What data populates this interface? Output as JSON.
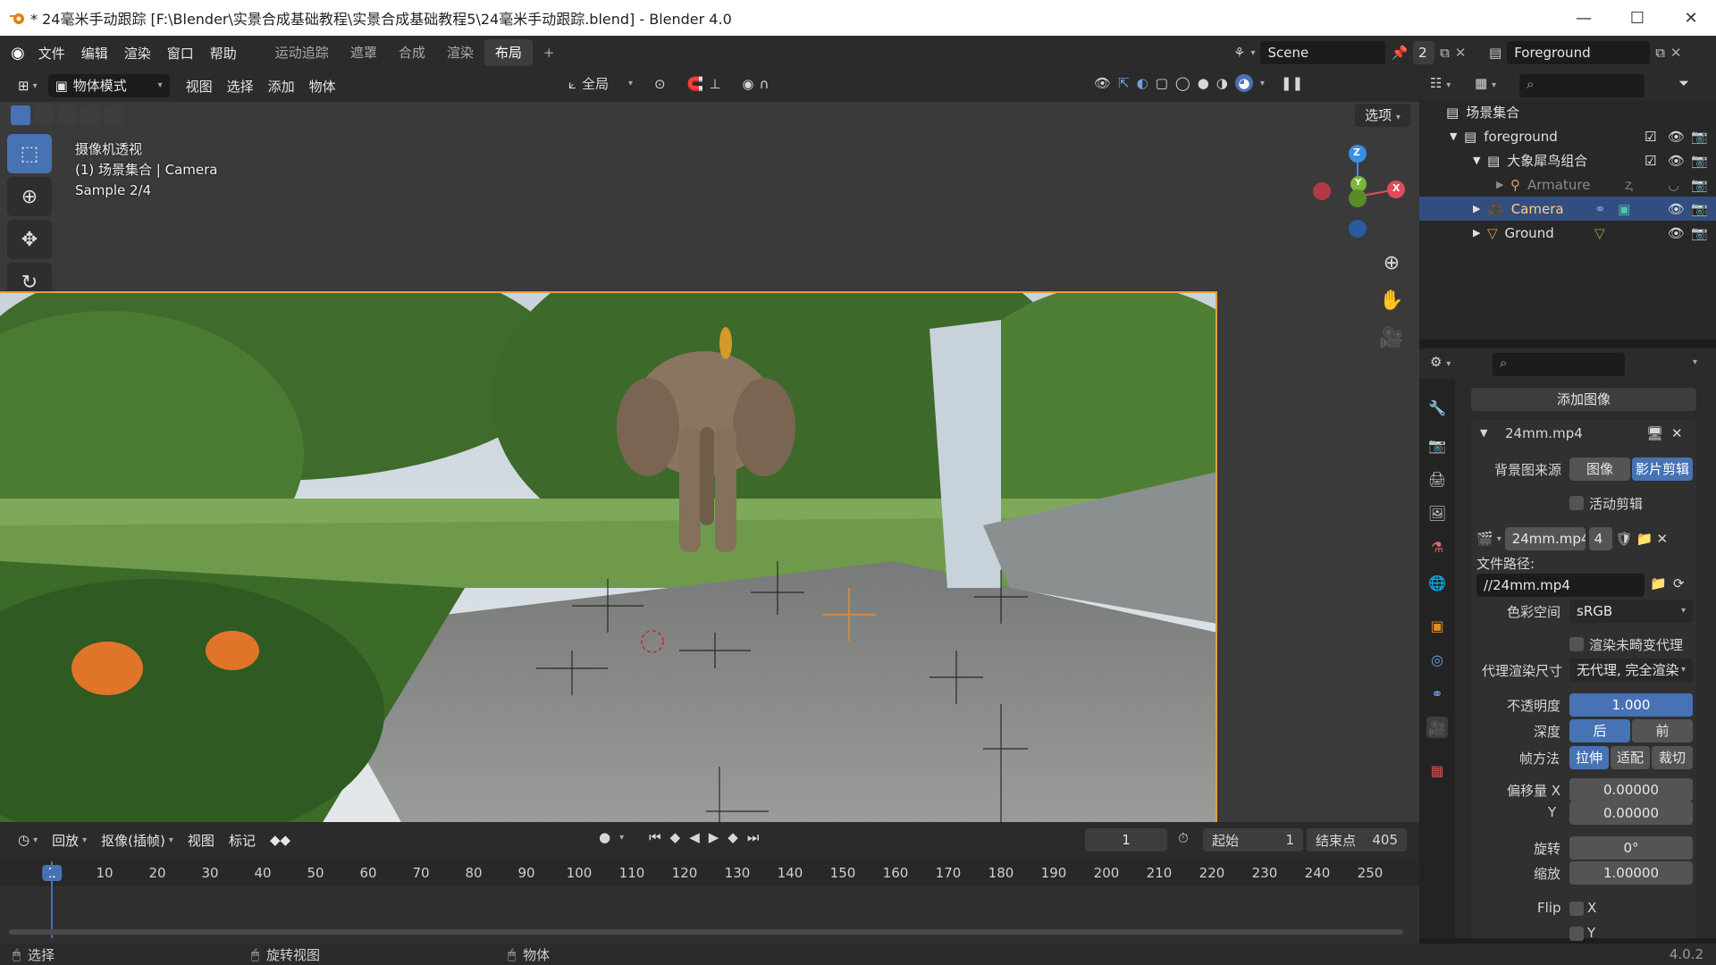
{
  "window": {
    "title": "* 24毫米手动跟踪 [F:\\Blender\\实景合成基础教程\\实景合成基础教程5\\24毫米手动跟踪.blend] - Blender 4.0",
    "minimize": "—",
    "maximize": "☐",
    "close": "✕"
  },
  "menu": {
    "items": [
      "文件",
      "编辑",
      "渲染",
      "窗口",
      "帮助"
    ],
    "workspaces": [
      "运动追踪",
      "遮罩",
      "合成",
      "渲染",
      "布局"
    ],
    "add": "+",
    "scene": "Scene",
    "scene_users": "2",
    "view_layer": "Foreground"
  },
  "viewport_header": {
    "mode": "物体模式",
    "items": [
      "视图",
      "选择",
      "添加",
      "物体"
    ],
    "transform_orient": "全局",
    "options": "选项"
  },
  "overlay": {
    "line1": "摄像机透视",
    "line2": "(1) 场景集合 | Camera",
    "line3": "Sample 2/4"
  },
  "gizmo": {
    "z": "Z",
    "y": "Y",
    "x": "X"
  },
  "outliner": {
    "root": "场景集合",
    "rows": [
      {
        "label": "foreground"
      },
      {
        "label": "大象犀鸟组合"
      },
      {
        "label": "Armature"
      },
      {
        "label": "Camera"
      },
      {
        "label": "Ground"
      }
    ]
  },
  "props": {
    "add_image": "添加图像",
    "clip_name": "24mm.mp4",
    "bg_source_label": "背景图来源",
    "bg_source_image": "图像",
    "bg_source_clip": "影片剪辑",
    "active_clip": "活动剪辑",
    "clip_block": "24mm.mp4",
    "clip_users": "4",
    "file_path_label": "文件路径:",
    "file_path": "//24mm.mp4",
    "colorspace_label": "色彩空间",
    "colorspace": "sRGB",
    "render_undistorted": "渲染未畸变代理",
    "proxy_size_label": "代理渲染尺寸",
    "proxy_size": "无代理, 完全渲染",
    "opacity_label": "不透明度",
    "opacity": "1.000",
    "depth_label": "深度",
    "depth_back": "后",
    "depth_front": "前",
    "frame_method_label": "帧方法",
    "fm_stretch": "拉伸",
    "fm_fit": "适配",
    "fm_crop": "裁切",
    "offset_x_label": "偏移量 X",
    "offset_x": "0.00000",
    "offset_y_label": "Y",
    "offset_y": "0.00000",
    "rotation_label": "旋转",
    "rotation": "0°",
    "scale_label": "缩放",
    "scale": "1.00000",
    "flip_label": "Flip",
    "flip_x": "X",
    "flip_y": "Y"
  },
  "timeline": {
    "playback": "回放",
    "keying": "抠像(插帧)",
    "view": "视图",
    "marker": "标记",
    "current_frame": "1",
    "start_label": "起始",
    "start": "1",
    "end_label": "结束点",
    "end": "405",
    "ticks": [
      "1",
      "10",
      "20",
      "30",
      "40",
      "50",
      "60",
      "70",
      "80",
      "90",
      "100",
      "110",
      "120",
      "130",
      "140",
      "150",
      "160",
      "170",
      "180",
      "190",
      "200",
      "210",
      "220",
      "230",
      "240",
      "250"
    ]
  },
  "status": {
    "select": "选择",
    "rotate_view": "旋转视图",
    "object": "物体",
    "version": "4.0.2"
  },
  "colors": {
    "accent": "#4772b3",
    "selected_row": "#334d80",
    "camera_orange": "#e0a040"
  }
}
